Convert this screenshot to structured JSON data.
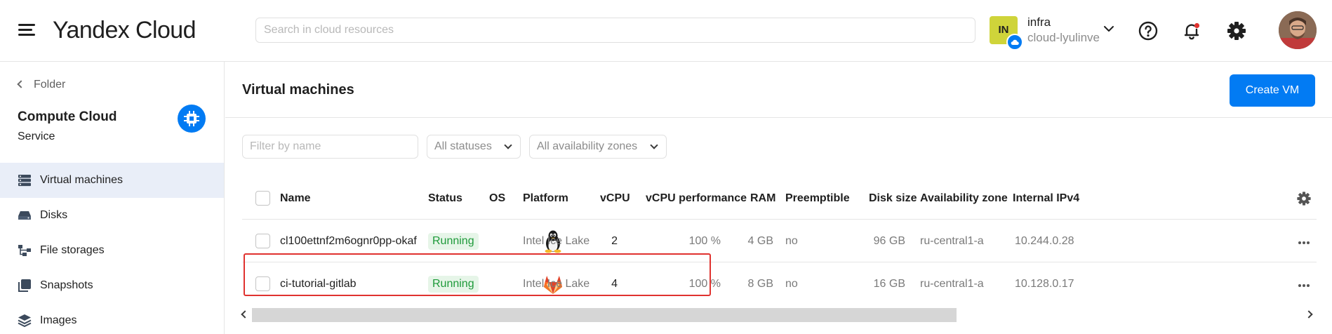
{
  "header": {
    "logo": "Yandex Cloud",
    "search_placeholder": "Search in cloud resources",
    "account": {
      "badge": "IN",
      "name": "infra",
      "cloud": "cloud-lyulinve"
    },
    "icons": [
      "menu-icon",
      "help-icon",
      "notification-bell-icon",
      "settings-gear-icon",
      "user-avatar"
    ]
  },
  "sidebar": {
    "back_label": "Folder",
    "service_title": "Compute Cloud",
    "service_subtitle": "Service",
    "items": [
      {
        "label": "Virtual machines",
        "icon": "server-icon",
        "active": true
      },
      {
        "label": "Disks",
        "icon": "disk-icon",
        "active": false
      },
      {
        "label": "File storages",
        "icon": "file-storage-icon",
        "active": false
      },
      {
        "label": "Snapshots",
        "icon": "snapshot-icon",
        "active": false
      },
      {
        "label": "Images",
        "icon": "layers-icon",
        "active": false
      }
    ]
  },
  "main": {
    "title": "Virtual machines",
    "create_button": "Create VM",
    "filter_placeholder": "Filter by name",
    "status_filter": "All statuses",
    "zone_filter": "All availability zones",
    "table": {
      "columns": [
        "Name",
        "Status",
        "OS",
        "Platform",
        "vCPU",
        "vCPU performance",
        "RAM",
        "Preemptible",
        "Disk size",
        "Availability zone",
        "Internal IPv4"
      ],
      "rows": [
        {
          "name": "cl100ettnf2m6ognr0pp-okaf",
          "status": "Running",
          "os": "linux-tux-icon",
          "platform": "Intel Ice Lake",
          "vcpu": "2",
          "vcpu_perf": "100 %",
          "ram": "4 GB",
          "preemptible": "no",
          "disk": "96 GB",
          "zone": "ru-central1-a",
          "ip": "10.244.0.28"
        },
        {
          "name": "ci-tutorial-gitlab",
          "status": "Running",
          "os": "gitlab-icon",
          "platform": "Intel Ice Lake",
          "vcpu": "4",
          "vcpu_perf": "100 %",
          "ram": "8 GB",
          "preemptible": "no",
          "disk": "16 GB",
          "zone": "ru-central1-a",
          "ip": "10.128.0.17"
        }
      ]
    }
  },
  "colors": {
    "accent": "#027bf3",
    "running_bg": "#e6f5e8",
    "running_text": "#1e9a3a",
    "highlight": "#e0322f",
    "account_badge": "#cfd43a"
  }
}
